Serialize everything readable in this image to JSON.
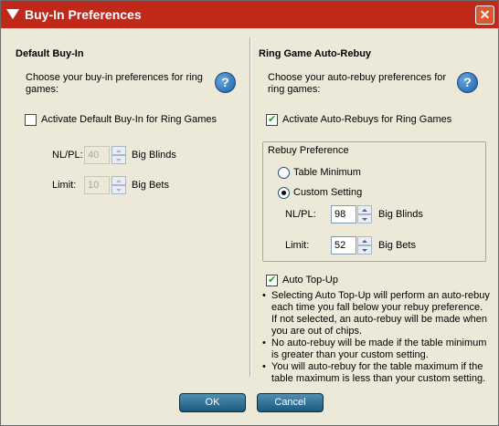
{
  "window": {
    "title": "Buy-In Preferences",
    "close_label": "✕"
  },
  "left": {
    "title": "Default Buy-In",
    "desc": "Choose your buy-in preferences for ring games:",
    "help_label": "?",
    "activate_label": "Activate Default Buy-In for Ring Games",
    "activate_checked": false,
    "nlpl": {
      "label": "NL/PL:",
      "value": "40",
      "unit": "Big Blinds"
    },
    "limit": {
      "label": "Limit:",
      "value": "10",
      "unit": "Big Bets"
    }
  },
  "right": {
    "title": "Ring Game Auto-Rebuy",
    "desc": "Choose your auto-rebuy preferences for ring games:",
    "help_label": "?",
    "activate_label": "Activate Auto-Rebuys for Ring Games",
    "activate_checked": true,
    "rebuy_preference": {
      "title": "Rebuy Preference",
      "table_minimum_label": "Table Minimum",
      "custom_setting_label": "Custom Setting",
      "selected": "custom",
      "nlpl": {
        "label": "NL/PL:",
        "value": "98",
        "unit": "Big Blinds"
      },
      "limit": {
        "label": "Limit:",
        "value": "52",
        "unit": "Big Bets"
      }
    },
    "auto_topup_label": "Auto Top-Up",
    "auto_topup_checked": true,
    "notes": [
      "Selecting Auto Top-Up will perform an auto-rebuy each time you fall below your rebuy preference. If not selected, an auto-rebuy will be made when you are out of chips.",
      "No auto-rebuy will be made if the table minimum is greater than your custom setting.",
      "You will auto-rebuy for the table maximum if the table maximum is less than your custom setting."
    ]
  },
  "buttons": {
    "ok": "OK",
    "cancel": "Cancel"
  }
}
